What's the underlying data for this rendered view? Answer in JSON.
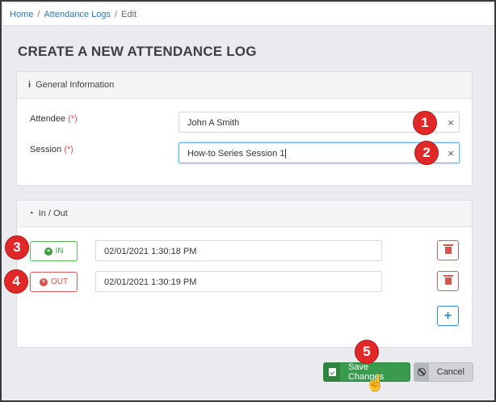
{
  "breadcrumb": {
    "home": "Home",
    "section": "Attendance Logs",
    "current": "Edit",
    "separator": "/"
  },
  "page_title": "CREATE A NEW ATTENDANCE LOG",
  "general_info": {
    "icon": "info-icon",
    "title": "General Information",
    "attendee_label": "Attendee",
    "session_label": "Session",
    "required_marker": "(*)",
    "attendee_value": "John A Smith",
    "session_value": "How-to Series Session 1",
    "clear_symbol": "×"
  },
  "in_out": {
    "icon": "clock-icon",
    "title": "In / Out",
    "entries": [
      {
        "type": "IN",
        "icon_glyph": "➜",
        "timestamp": "02/01/2021 1:30:18 PM"
      },
      {
        "type": "OUT",
        "icon_glyph": "⏵",
        "timestamp": "02/01/2021 1:30:19 PM"
      }
    ],
    "add_symbol": "+"
  },
  "annotations": [
    "1",
    "2",
    "3",
    "4",
    "5"
  ],
  "actions": {
    "save_label": "Save Changes",
    "cancel_label": "Cancel"
  },
  "colors": {
    "badge": "#e02828",
    "save": "#3a9a4e",
    "in": "#3d9b3d",
    "out": "#d9534f",
    "link": "#2a7ab8"
  }
}
